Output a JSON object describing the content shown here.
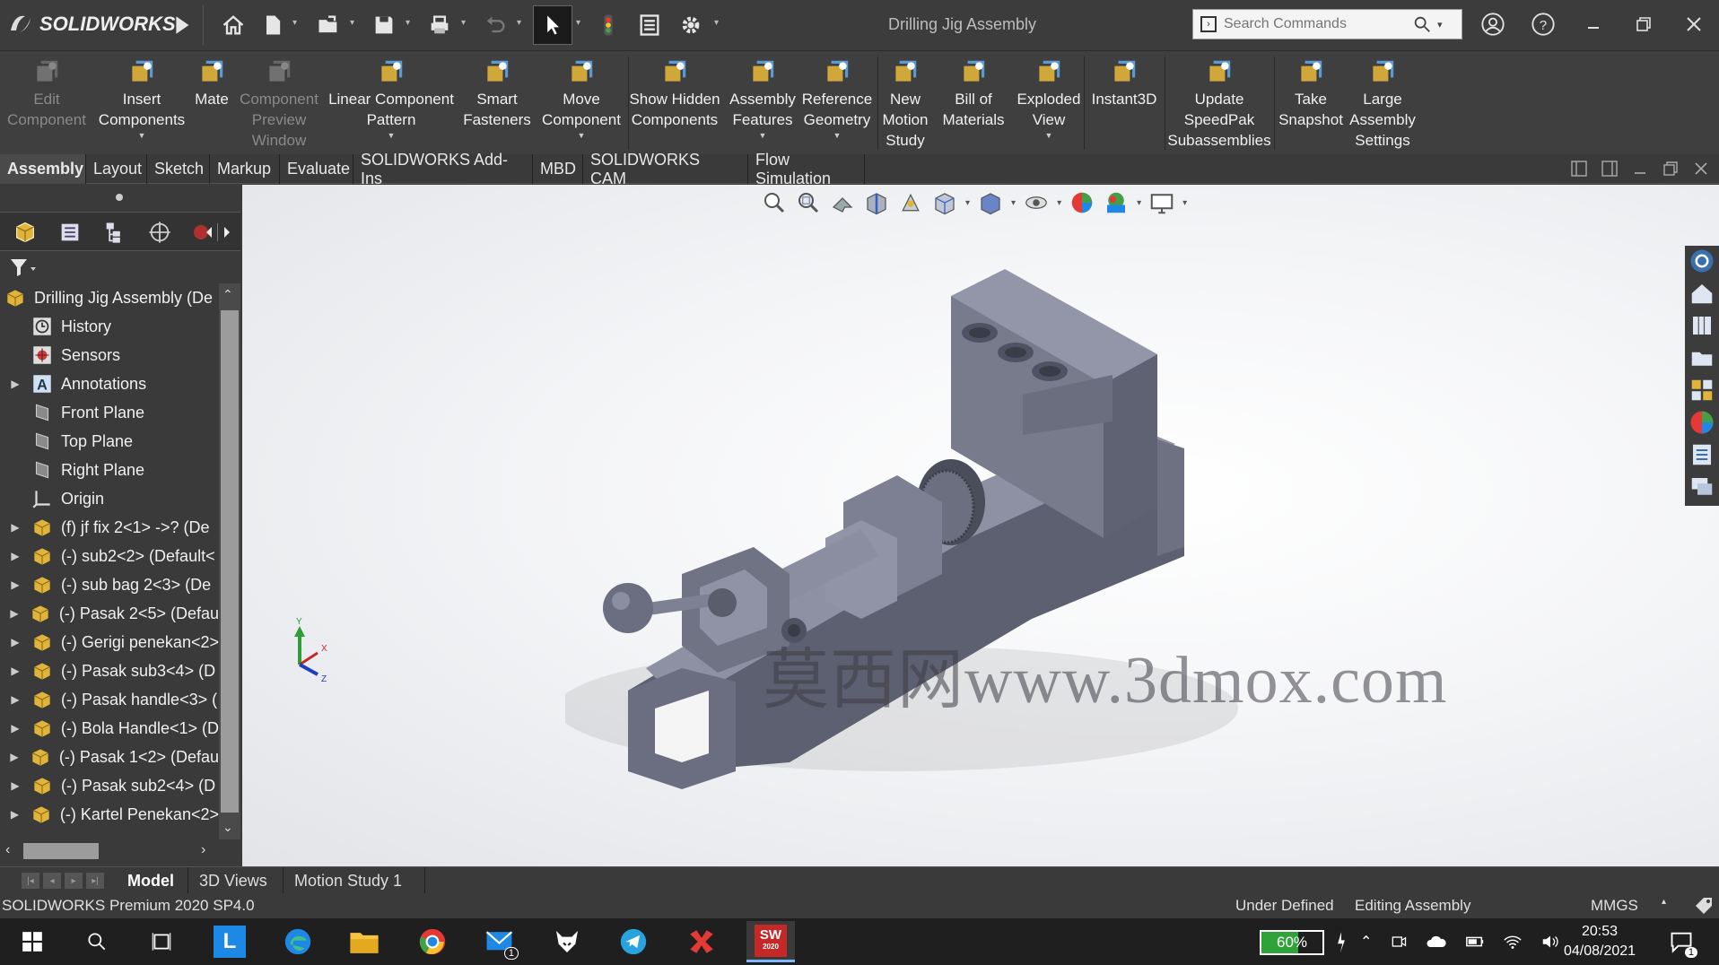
{
  "app": {
    "brand": "SOLIDWORKS",
    "document_title": "Drilling Jig Assembly"
  },
  "search": {
    "placeholder": "Search Commands"
  },
  "ribbon": [
    {
      "label": "Edit Component",
      "enabled": false,
      "icon": "edit-component-icon"
    },
    {
      "label": "Insert Components",
      "enabled": true,
      "icon": "insert-components-icon",
      "dropdown": true
    },
    {
      "label": "Mate",
      "enabled": true,
      "icon": "mate-icon"
    },
    {
      "label": "Component Preview Window",
      "enabled": false,
      "icon": "component-preview-icon"
    },
    {
      "label": "Linear Component Pattern",
      "enabled": true,
      "icon": "linear-pattern-icon",
      "dropdown": true
    },
    {
      "label": "Smart Fasteners",
      "enabled": true,
      "icon": "smart-fasteners-icon"
    },
    {
      "label": "Move Component",
      "enabled": true,
      "icon": "move-component-icon",
      "dropdown": true
    },
    {
      "label": "Show Hidden Components",
      "enabled": true,
      "icon": "show-hidden-icon"
    },
    {
      "label": "Assembly Features",
      "enabled": true,
      "icon": "assembly-features-icon",
      "dropdown": true
    },
    {
      "label": "Reference Geometry",
      "enabled": true,
      "icon": "reference-geometry-icon",
      "dropdown": true
    },
    {
      "label": "New Motion Study",
      "enabled": true,
      "icon": "motion-study-icon"
    },
    {
      "label": "Bill of Materials",
      "enabled": true,
      "icon": "bill-of-materials-icon"
    },
    {
      "label": "Exploded View",
      "enabled": true,
      "icon": "exploded-view-icon",
      "dropdown": true
    },
    {
      "label": "Instant3D",
      "enabled": true,
      "icon": "instant3d-icon"
    },
    {
      "label": "Update SpeedPak Subassemblies",
      "enabled": true,
      "icon": "speedpak-icon"
    },
    {
      "label": "Take Snapshot",
      "enabled": true,
      "icon": "camera-icon"
    },
    {
      "label": "Large Assembly Settings",
      "enabled": true,
      "icon": "large-assembly-icon"
    }
  ],
  "tabs": [
    "Assembly",
    "Layout",
    "Sketch",
    "Markup",
    "Evaluate",
    "SOLIDWORKS Add-Ins",
    "MBD",
    "SOLIDWORKS CAM",
    "Flow Simulation"
  ],
  "tree": [
    {
      "label": "Drilling Jig Assembly  (De",
      "icon": "assembly-icon",
      "expandable": false
    },
    {
      "label": "History",
      "icon": "history-icon",
      "expandable": false
    },
    {
      "label": "Sensors",
      "icon": "sensors-icon",
      "expandable": false
    },
    {
      "label": "Annotations",
      "icon": "annotations-icon",
      "expandable": true
    },
    {
      "label": "Front Plane",
      "icon": "plane-icon",
      "expandable": false
    },
    {
      "label": "Top Plane",
      "icon": "plane-icon",
      "expandable": false
    },
    {
      "label": "Right Plane",
      "icon": "plane-icon",
      "expandable": false
    },
    {
      "label": "Origin",
      "icon": "origin-icon",
      "expandable": false
    },
    {
      "label": "(f) jf fix 2<1> ->? (De",
      "icon": "part-icon",
      "expandable": true
    },
    {
      "label": "(-) sub2<2> (Default<",
      "icon": "part-icon",
      "expandable": true
    },
    {
      "label": "(-) sub bag 2<3> (De",
      "icon": "part-icon",
      "expandable": true
    },
    {
      "label": "(-) Pasak 2<5> (Defau",
      "icon": "part-icon",
      "expandable": true
    },
    {
      "label": "(-) Gerigi penekan<2>",
      "icon": "part-icon",
      "expandable": true
    },
    {
      "label": "(-) Pasak sub3<4> (D",
      "icon": "part-icon",
      "expandable": true
    },
    {
      "label": "(-) Pasak handle<3> (",
      "icon": "part-icon",
      "expandable": true
    },
    {
      "label": "(-) Bola Handle<1> (D",
      "icon": "part-icon",
      "expandable": true
    },
    {
      "label": "(-) Pasak 1<2> (Defau",
      "icon": "part-icon",
      "expandable": true
    },
    {
      "label": "(-) Pasak sub2<4> (D",
      "icon": "part-icon",
      "expandable": true
    },
    {
      "label": "(-) Kartel Penekan<2>",
      "icon": "part-icon",
      "expandable": true
    }
  ],
  "watermark": "莫西网www.3dmox.com",
  "triad": {
    "x": "X",
    "y": "Y",
    "z": "Z"
  },
  "bottom_tabs": [
    "Model",
    "3D Views",
    "Motion Study 1"
  ],
  "status": {
    "version": "SOLIDWORKS Premium 2020 SP4.0",
    "state": "Under Defined",
    "mode": "Editing Assembly",
    "units": "MMGS"
  },
  "taskbar": {
    "battery": "60%",
    "time": "20:53",
    "date": "04/08/2021",
    "mail_badge": "1",
    "notif_badge": "1",
    "sw_year": "2020"
  },
  "colors": {
    "accent_blue": "#1e88e5",
    "part_yellow": "#e0b43a",
    "model_gray": "#707585"
  }
}
